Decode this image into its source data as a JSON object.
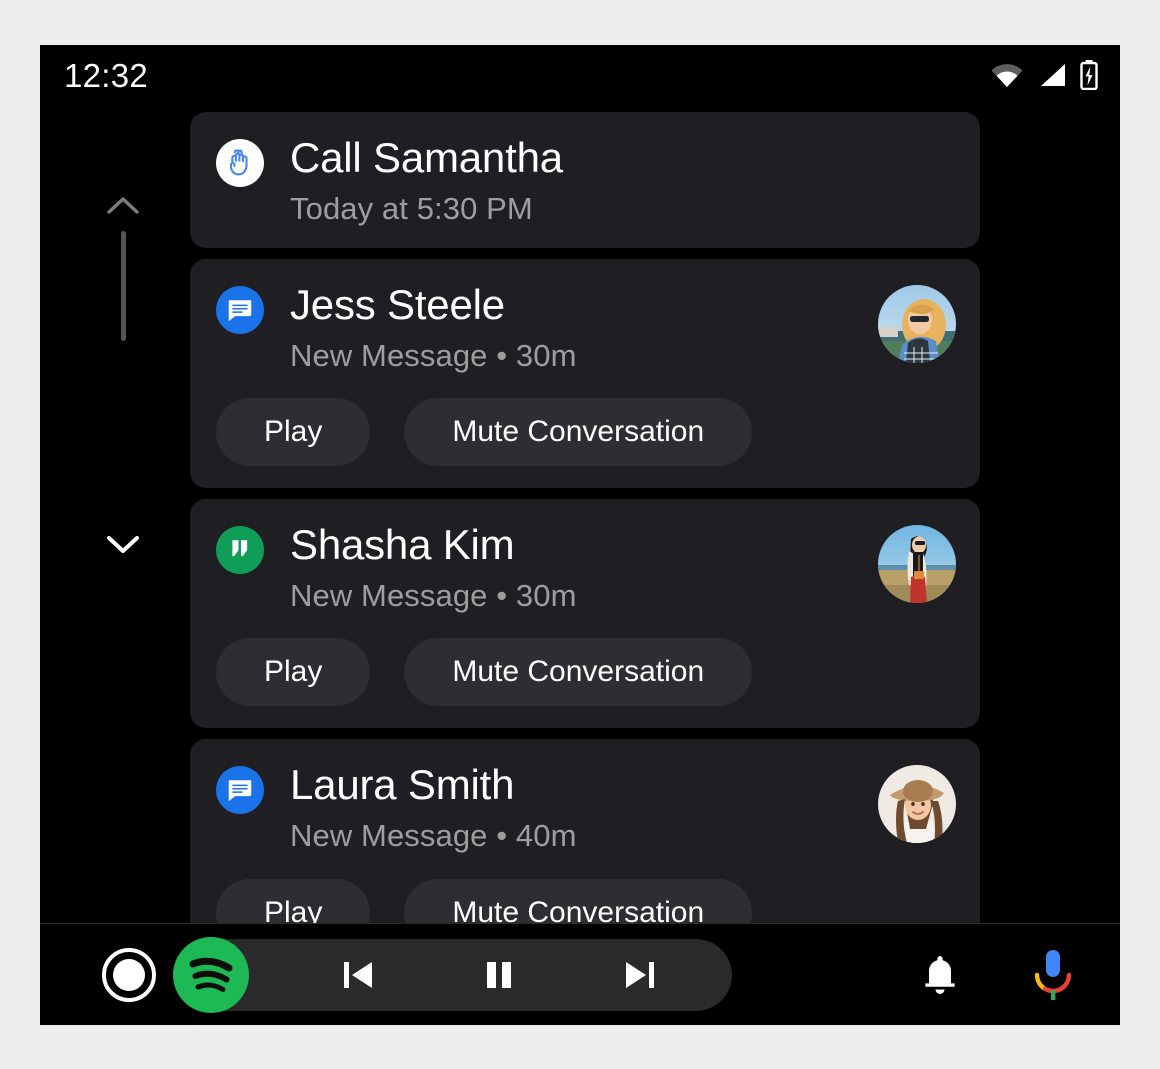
{
  "status_bar": {
    "clock": "12:32",
    "icons": [
      "wifi-icon",
      "cell-signal-icon",
      "battery-charging-icon"
    ]
  },
  "scroll": {
    "up_icon": "chevron-up-icon",
    "down_icon": "chevron-down-icon",
    "thumb_position": "top"
  },
  "notifications": [
    {
      "app_icon": "reminder-hand-icon",
      "icon_style": "white",
      "title": "Call Samantha",
      "subtitle": "Today at 5:30 PM",
      "avatar": null,
      "actions": []
    },
    {
      "app_icon": "messages-icon",
      "icon_style": "blue",
      "title": "Jess Steele",
      "subtitle": "New Message • 30m",
      "avatar": "avatar-jess",
      "actions": [
        "Play",
        "Mute Conversation"
      ]
    },
    {
      "app_icon": "hangouts-icon",
      "icon_style": "green",
      "title": "Shasha Kim",
      "subtitle": "New Message • 30m",
      "avatar": "avatar-shasha",
      "actions": [
        "Play",
        "Mute Conversation"
      ]
    },
    {
      "app_icon": "messages-icon",
      "icon_style": "blue",
      "title": "Laura Smith",
      "subtitle": "New Message • 40m",
      "avatar": "avatar-laura",
      "actions": [
        "Play",
        "Mute Conversation"
      ]
    }
  ],
  "nav_bar": {
    "home_icon": "circle-home-icon",
    "media_app_icon": "spotify-icon",
    "previous_icon": "skip-previous-icon",
    "play_pause_icon": "pause-icon",
    "next_icon": "skip-next-icon",
    "notifications_icon": "bell-icon",
    "assistant_icon": "google-assistant-mic-icon"
  },
  "colors": {
    "background": "#000000",
    "card": "#1f1f23",
    "pill": "#2e2e32",
    "title_text": "#ffffff",
    "subtitle_text": "#9e9e9e",
    "accent_blue": "#1a73e8",
    "accent_green": "#0f9d58",
    "spotify_green": "#1db954"
  }
}
